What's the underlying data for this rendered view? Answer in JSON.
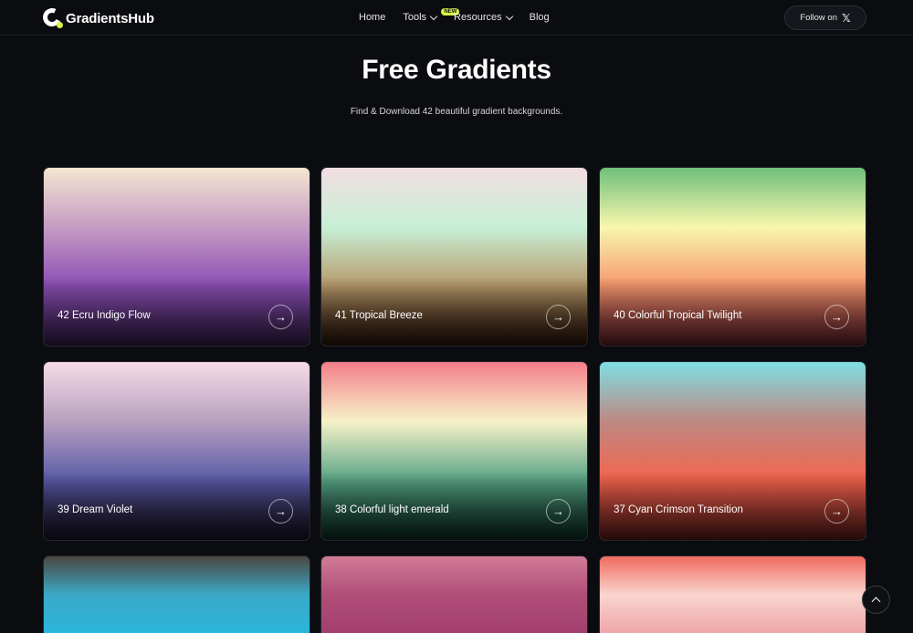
{
  "header": {
    "brand": "GradientsHub",
    "nav": [
      {
        "label": "Home"
      },
      {
        "label": "Tools",
        "badge": "NEW"
      },
      {
        "label": "Resources"
      },
      {
        "label": "Blog"
      }
    ],
    "follow_label": "Follow on",
    "follow_icon": "x-logo-icon"
  },
  "hero": {
    "title": "Free Gradients",
    "subtitle": "Find & Download 42 beautiful gradient backgrounds."
  },
  "cards": [
    {
      "label": "42 Ecru Indigo Flow",
      "colors": [
        "#f4e6cf",
        "#c59bc4",
        "#8c4fb4",
        "#7c45ab"
      ]
    },
    {
      "label": "41 Tropical Breeze",
      "colors": [
        "#f3dde2",
        "#c7f0d6",
        "#b69a6c",
        "#6b381f"
      ]
    },
    {
      "label": "40 Colorful Tropical Twilight",
      "colors": [
        "#6ec07a",
        "#f8f6ad",
        "#f6986e",
        "#e2545e"
      ]
    },
    {
      "label": "39 Dream Violet",
      "colors": [
        "#f6dbe6",
        "#b7a0bf",
        "#5b5ba8",
        "#3b2f58"
      ]
    },
    {
      "label": "38 Colorful light emerald",
      "colors": [
        "#f47d8b",
        "#f6f2c8",
        "#5aa486",
        "#1f6d55"
      ]
    },
    {
      "label": "37 Cyan Crimson Transition",
      "colors": [
        "#7fdfe4",
        "#bd8882",
        "#f4654e",
        "#e2473f"
      ]
    },
    {
      "label": "",
      "colors": [
        "#4a4640",
        "#3ca9c7",
        "#2ab6dc"
      ]
    },
    {
      "label": "",
      "colors": [
        "#d27b95",
        "#b04e78",
        "#a33f6e"
      ]
    },
    {
      "label": "",
      "colors": [
        "#f06a5e",
        "#f9d5cf",
        "#f0a6a8"
      ]
    }
  ]
}
